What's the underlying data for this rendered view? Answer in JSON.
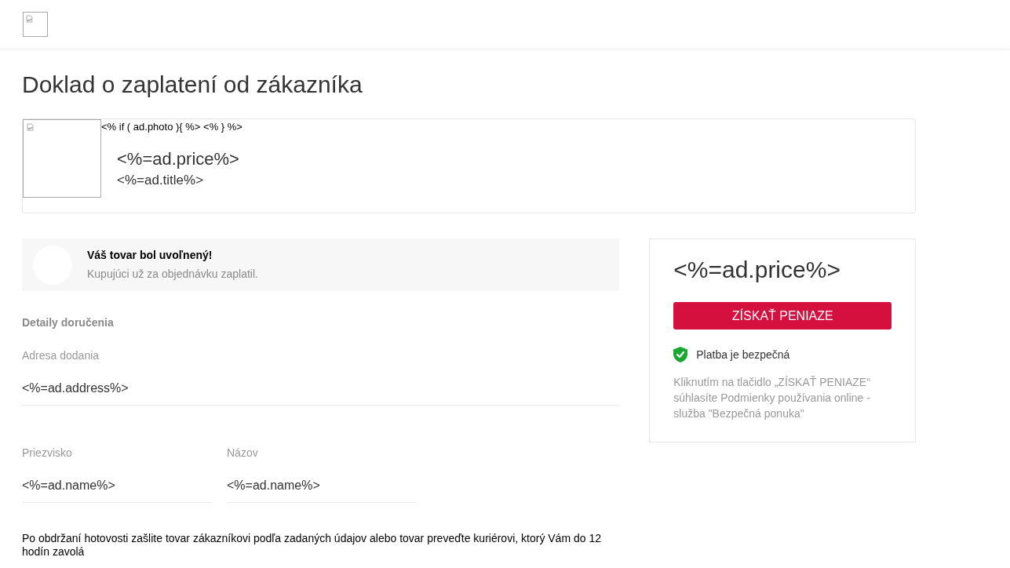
{
  "page_title": "Doklad o zaplatení od zákazníka",
  "ad_card": {
    "template_text": "<% if ( ad.photo ){ %> <% } %>",
    "price": "<%=ad.price%>",
    "title": "<%=ad.title%>"
  },
  "notice": {
    "title": "Váš tovar bol uvoľnený!",
    "text": "Kupujúci už za objednávku zaplatil."
  },
  "delivery": {
    "heading": "Detaily doručenia",
    "address": {
      "label": "Adresa dodania",
      "value": "<%=ad.address%>"
    },
    "name_fields": [
      {
        "label": "Priezvisko",
        "value": "<%=ad.name%>"
      },
      {
        "label": "Názov",
        "value": "<%=ad.name%>"
      }
    ],
    "note": "Po obdržaní hotovosti zašlite tovar zákazníkovi podľa zadaných údajov alebo tovar preveďte kuriérovi, ktorý Vám do 12 hodín zavolá"
  },
  "summary": {
    "price": "<%=ad.price%>",
    "button": "ZÍSKAŤ PENIAZE",
    "secure_label": "Platba je bezpečná",
    "disclaimer": "Kliknutím na tlačidlo „ZÍSKAŤ PENIAZE“ súhlasíte Podmienky používania online - služba \"Bezpečná ponuka\""
  }
}
